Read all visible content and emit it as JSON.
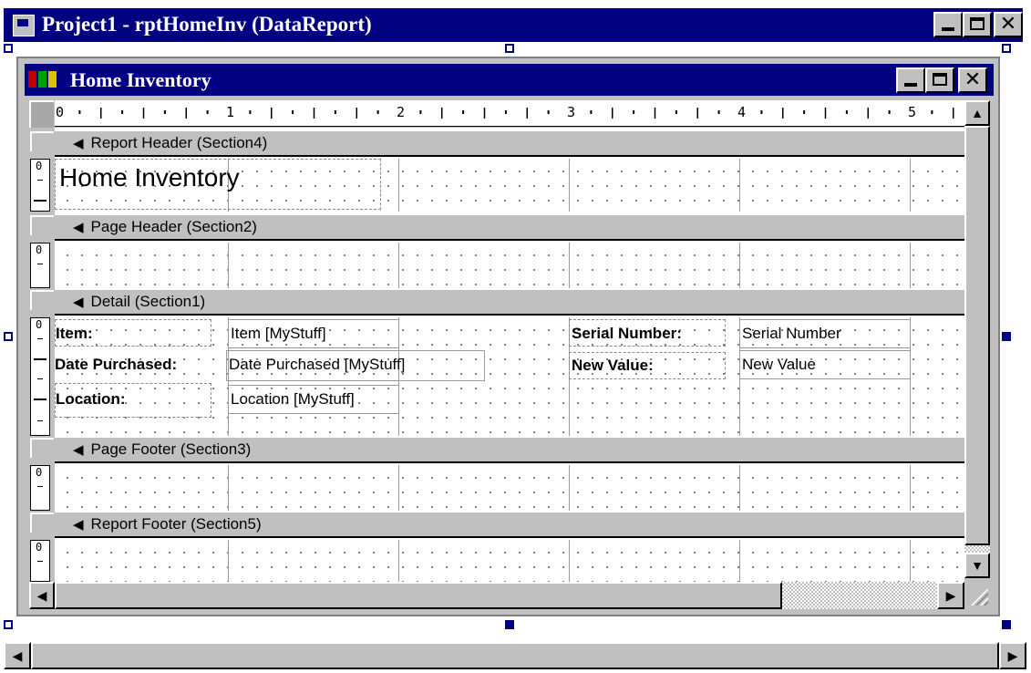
{
  "outer_window": {
    "title": "Project1 - rptHomeInv (DataReport)",
    "controls": {
      "minimize": "minimize",
      "maximize": "maximize",
      "close": "✕"
    }
  },
  "inner_window": {
    "title": "Home Inventory",
    "controls": {
      "minimize": "minimize",
      "maximize": "maximize",
      "close": "✕"
    }
  },
  "ruler": {
    "labels": [
      "0",
      "1",
      "2",
      "3",
      "4",
      "5"
    ]
  },
  "vertical_ruler": {
    "zero": "0"
  },
  "sections": [
    {
      "id": "report_header",
      "label": "Report Header (Section4)"
    },
    {
      "id": "page_header",
      "label": "Page Header (Section2)"
    },
    {
      "id": "detail",
      "label": "Detail (Section1)"
    },
    {
      "id": "page_footer",
      "label": "Page Footer (Section3)"
    },
    {
      "id": "report_footer",
      "label": "Report Footer (Section5)"
    }
  ],
  "report_header": {
    "title_label": "Home Inventory"
  },
  "detail": {
    "item_label": "Item:",
    "item_field": "Item [MyStuff]",
    "date_label": "Date Purchased:",
    "date_field": "Date Purchased [MyStuff]",
    "location_label": "Location:",
    "location_field": "Location [MyStuff]",
    "serial_label": "Serial Number:",
    "serial_field": "Serial Number",
    "value_label": "New Value:",
    "value_field": "New Value"
  },
  "icons": {
    "section_arrow": "section-arrow-icon",
    "scroll_up": "▲",
    "scroll_down": "▼",
    "scroll_left": "◀",
    "scroll_right": "▶"
  },
  "colors": {
    "title_bar": "#000080",
    "chrome": "#c0c0c0",
    "handle": "#000080"
  }
}
